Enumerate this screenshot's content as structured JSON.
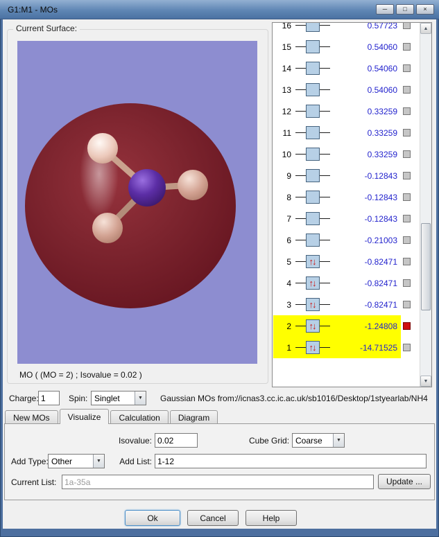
{
  "window": {
    "title": "G1:M1 - MOs"
  },
  "icons": {
    "minimize": "─",
    "maximize": "□",
    "close": "×",
    "dropdown_arrow": "▼",
    "scroll_up": "▲",
    "scroll_down": "▼",
    "spin_up": "↑",
    "spin_down": "↓"
  },
  "colors": {
    "highlight": "#ffff00",
    "energy": "#2323cd",
    "arrow": "#cc1414",
    "checked": "#cf0f0f",
    "mobox": "#b7d0e6",
    "viewport_bg": "#8d8dd0",
    "surface_red": "#7c242e",
    "titlebar_blue": "#5f86b4",
    "titlebar_light": "#93b0d2"
  },
  "surface": {
    "label": "Current Surface:",
    "caption": "MO ( (MO = 2) ; Isovalue = 0.02 )"
  },
  "mo_list": {
    "rows": [
      {
        "num": "16",
        "energy": "0.57723",
        "occupied": false,
        "highlight": false,
        "checked": false
      },
      {
        "num": "15",
        "energy": "0.54060",
        "occupied": false,
        "highlight": false,
        "checked": false
      },
      {
        "num": "14",
        "energy": "0.54060",
        "occupied": false,
        "highlight": false,
        "checked": false
      },
      {
        "num": "13",
        "energy": "0.54060",
        "occupied": false,
        "highlight": false,
        "checked": false
      },
      {
        "num": "12",
        "energy": "0.33259",
        "occupied": false,
        "highlight": false,
        "checked": false
      },
      {
        "num": "11",
        "energy": "0.33259",
        "occupied": false,
        "highlight": false,
        "checked": false
      },
      {
        "num": "10",
        "energy": "0.33259",
        "occupied": false,
        "highlight": false,
        "checked": false
      },
      {
        "num": "9",
        "energy": "-0.12843",
        "occupied": false,
        "highlight": false,
        "checked": false
      },
      {
        "num": "8",
        "energy": "-0.12843",
        "occupied": false,
        "highlight": false,
        "checked": false
      },
      {
        "num": "7",
        "energy": "-0.12843",
        "occupied": false,
        "highlight": false,
        "checked": false
      },
      {
        "num": "6",
        "energy": "-0.21003",
        "occupied": false,
        "highlight": false,
        "checked": false
      },
      {
        "num": "5",
        "energy": "-0.82471",
        "occupied": true,
        "highlight": false,
        "checked": false
      },
      {
        "num": "4",
        "energy": "-0.82471",
        "occupied": true,
        "highlight": false,
        "checked": false
      },
      {
        "num": "3",
        "energy": "-0.82471",
        "occupied": true,
        "highlight": false,
        "checked": false
      },
      {
        "num": "2",
        "energy": "-1.24808",
        "occupied": true,
        "highlight": true,
        "checked": true
      },
      {
        "num": "1",
        "energy": "-14.71525",
        "occupied": true,
        "highlight": true,
        "checked": false
      }
    ]
  },
  "charge_row": {
    "charge_label": "Charge:",
    "charge_value": "1",
    "spin_label": "Spin:",
    "spin_value": "Singlet",
    "source_label": "Gaussian MOs from:",
    "source_path": "//icnas3.cc.ic.ac.uk/sb1016/Desktop/1styearlab/NH4"
  },
  "tabs": [
    {
      "label": "New MOs"
    },
    {
      "label": "Visualize"
    },
    {
      "label": "Calculation"
    },
    {
      "label": "Diagram"
    }
  ],
  "visualize_tab": {
    "isovalue_label": "Isovalue:",
    "isovalue_value": "0.02",
    "cube_grid_label": "Cube Grid:",
    "cube_grid_value": "Coarse",
    "add_type_label": "Add Type:",
    "add_type_value": "Other",
    "add_list_label": "Add List:",
    "add_list_value": "1-12",
    "current_list_label": "Current List:",
    "current_list_value": "1a-35a",
    "update_button": "Update ..."
  },
  "dialog_buttons": {
    "ok": "Ok",
    "cancel": "Cancel",
    "help": "Help"
  }
}
